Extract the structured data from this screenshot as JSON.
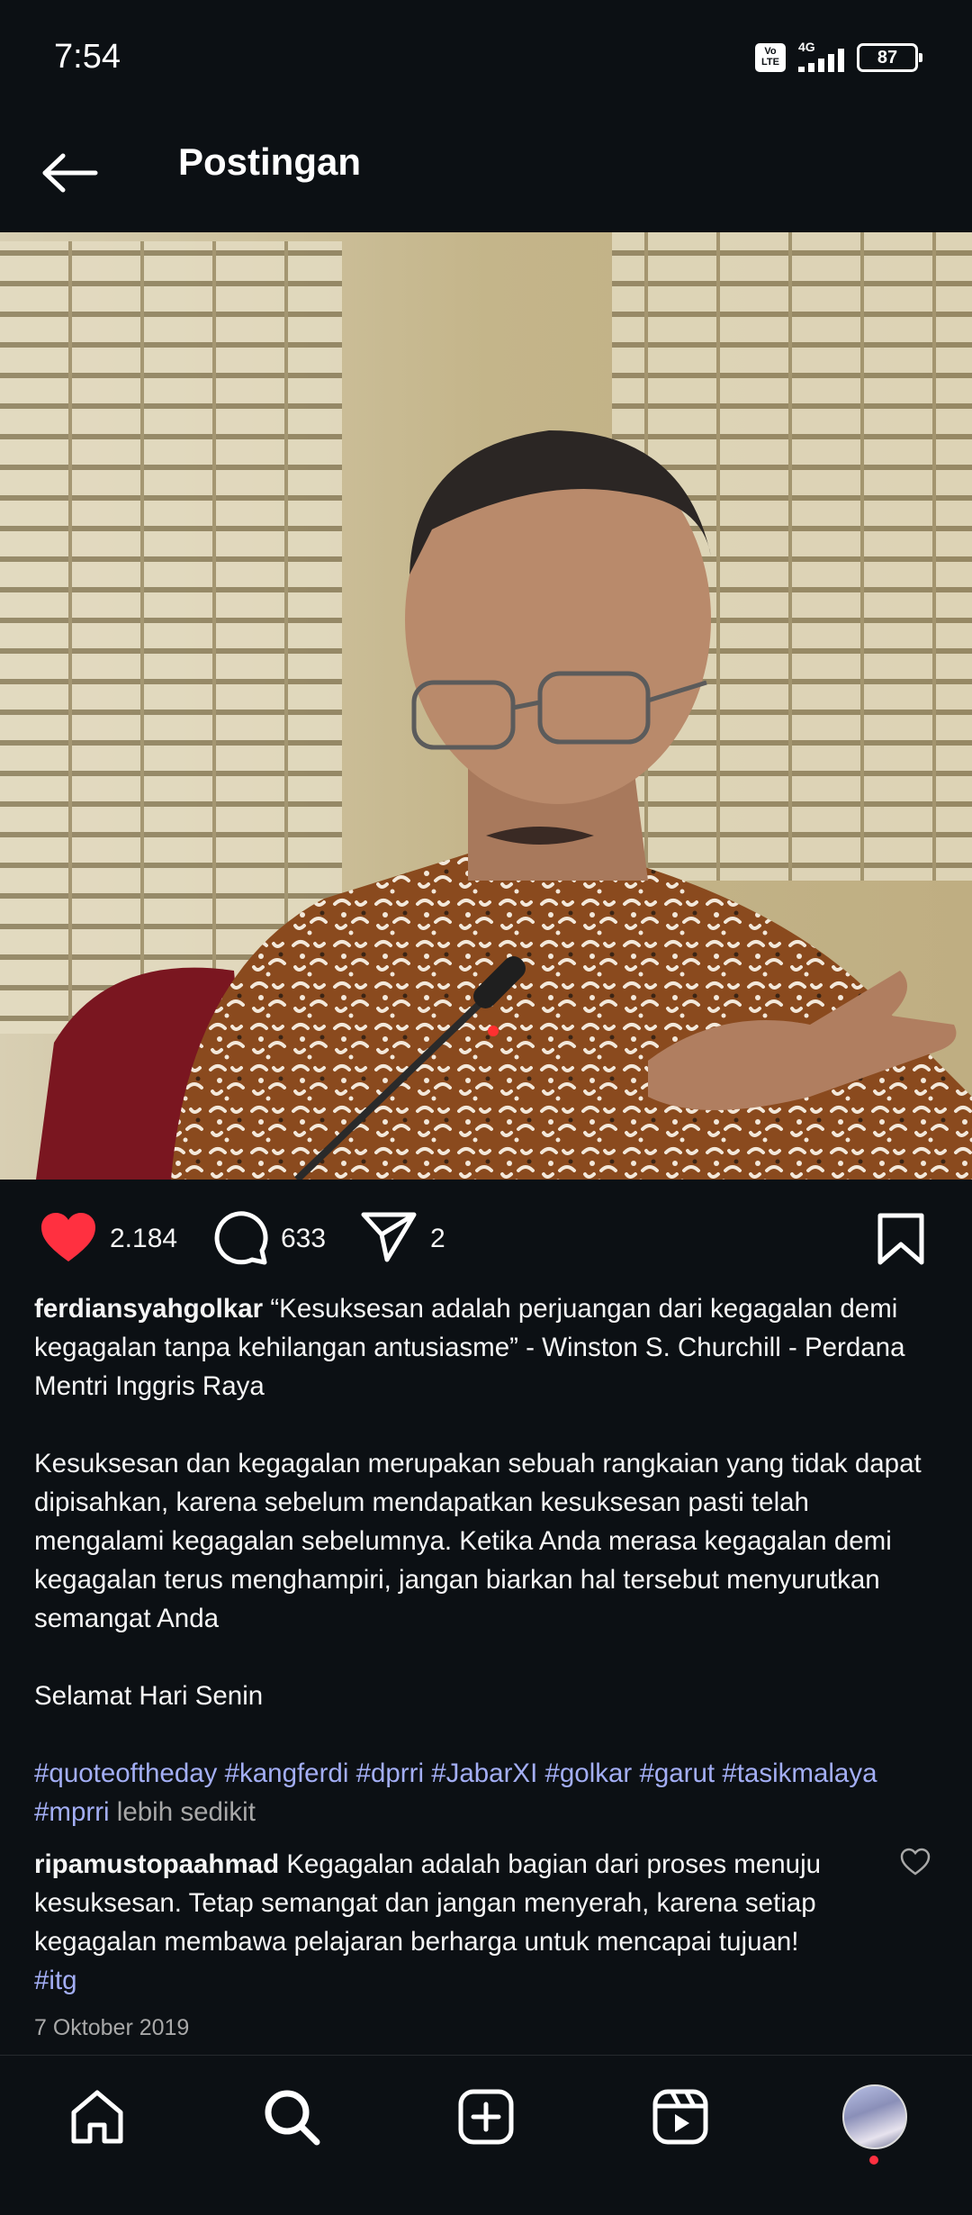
{
  "status_bar": {
    "time": "7:54",
    "volte": "Vo LTE",
    "network": "4G",
    "battery": "87"
  },
  "header": {
    "title": "Postingan"
  },
  "post": {
    "likes": "2.184",
    "comments": "633",
    "shares": "2",
    "caption": {
      "username": "ferdiansyahgolkar",
      "quote": "“Kesuksesan adalah perjuangan dari kegagalan demi kegagalan tanpa kehilangan antusiasme” - Winston S. Churchill - Perdana Mentri Inggris Raya",
      "paragraph": "Kesuksesan dan kegagalan merupakan sebuah rangkaian yang tidak dapat dipisahkan, karena sebelum mendapatkan kesuksesan pasti telah mengalami kegagalan sebelumnya. Ketika Anda merasa kegagalan demi kegagalan terus menghampiri, jangan biarkan hal tersebut menyurutkan semangat Anda",
      "greeting": "Selamat Hari Senin",
      "hashtags": [
        "#quoteoftheday",
        "#kangferdi",
        "#dprri",
        "#JabarXI",
        "#golkar",
        "#garut",
        "#tasikmalaya",
        "#mprri"
      ],
      "less_label": "lebih sedikit"
    },
    "comment": {
      "username": "ripamustopaahmad",
      "text": "Kegagalan adalah bagian dari proses menuju kesuksesan. Tetap semangat dan jangan menyerah, karena setiap kegagalan membawa pelajaran berharga untuk mencapai tujuan!",
      "hashtag": "#itg"
    },
    "date": "7 Oktober 2019"
  },
  "icons": {
    "like": "heart-icon",
    "comment": "comment-icon",
    "share": "send-icon",
    "save": "bookmark-icon"
  },
  "colors": {
    "background": "#0c1014",
    "liked": "#ff3040",
    "hashtag": "#a3aef5",
    "muted": "#a8a8a8"
  }
}
